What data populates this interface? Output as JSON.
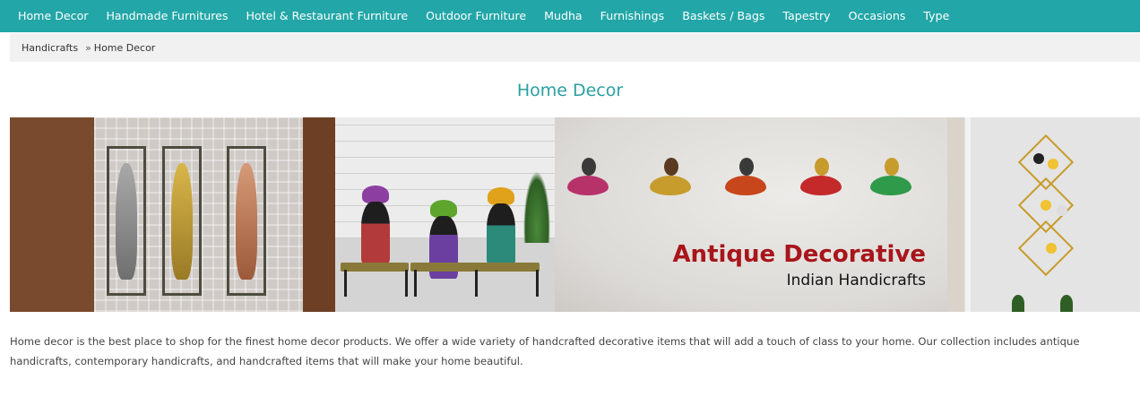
{
  "nav": {
    "items": [
      {
        "label": "Home Decor"
      },
      {
        "label": "Handmade Furnitures"
      },
      {
        "label": "Hotel & Restaurant Furniture"
      },
      {
        "label": "Outdoor Furniture"
      },
      {
        "label": "Mudha"
      },
      {
        "label": "Furnishings"
      },
      {
        "label": "Baskets / Bags"
      },
      {
        "label": "Tapestry"
      },
      {
        "label": "Occasions"
      },
      {
        "label": "Type"
      }
    ]
  },
  "breadcrumb": {
    "root": "Handicrafts",
    "separator": "»",
    "current": "Home Decor"
  },
  "page": {
    "title": "Home Decor"
  },
  "banner": {
    "headline": "Antique Decorative",
    "subline": "Indian Handicrafts"
  },
  "description": "Home decor is the best place to shop for the finest home decor products. We offer a wide variety of handcrafted decorative items that will add a touch of class to your home. Our collection includes antique handicrafts, contemporary handicrafts, and handcrafted items that will make your home beautiful.",
  "colors": {
    "nav_bg": "#22a6a7",
    "title": "#2a9fa1",
    "banner_headline": "#a8151b"
  }
}
